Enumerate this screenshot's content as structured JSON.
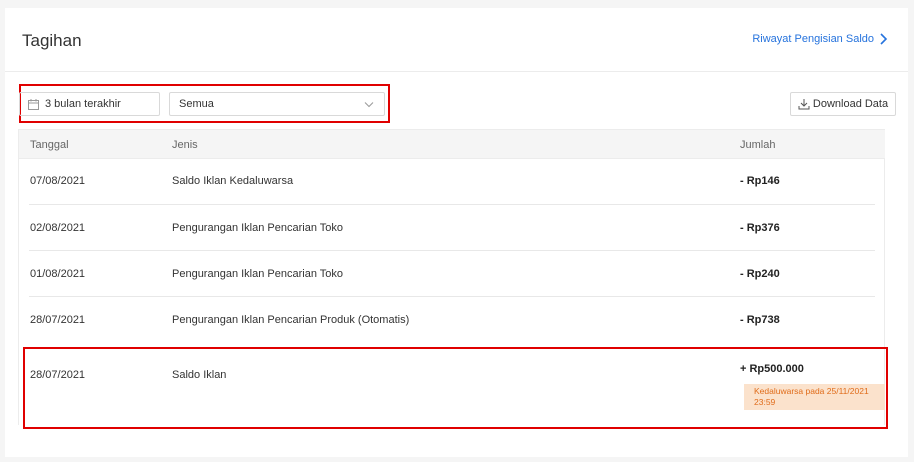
{
  "header": {
    "title": "Tagihan",
    "history_link": "Riwayat Pengisian Saldo"
  },
  "filters": {
    "date_range": "3 bulan terakhir",
    "type_select": "Semua",
    "download_label": "Download Data"
  },
  "table": {
    "columns": [
      "Tanggal",
      "Jenis",
      "Jumlah"
    ],
    "rows": [
      {
        "date": "07/08/2021",
        "type": "Saldo Iklan Kedaluwarsa",
        "amount": "- Rp146"
      },
      {
        "date": "02/08/2021",
        "type": "Pengurangan Iklan Pencarian Toko",
        "amount": "- Rp376"
      },
      {
        "date": "01/08/2021",
        "type": "Pengurangan Iklan Pencarian Toko",
        "amount": "- Rp240"
      },
      {
        "date": "28/07/2021",
        "type": "Pengurangan Iklan Pencarian Produk (Otomatis)",
        "amount": "- Rp738"
      },
      {
        "date": "28/07/2021",
        "type": "Saldo Iklan",
        "amount": "+ Rp500.000",
        "badge": "Kedaluwarsa pada 25/11/2021 23:59"
      }
    ]
  },
  "colors": {
    "link": "#2673dd",
    "highlight": "#e00000",
    "badge_bg": "#fbe2cc",
    "badge_text": "#e06c1a"
  },
  "icons": [
    "chevron-right-icon",
    "calendar-icon",
    "chevron-down-icon",
    "download-icon"
  ]
}
